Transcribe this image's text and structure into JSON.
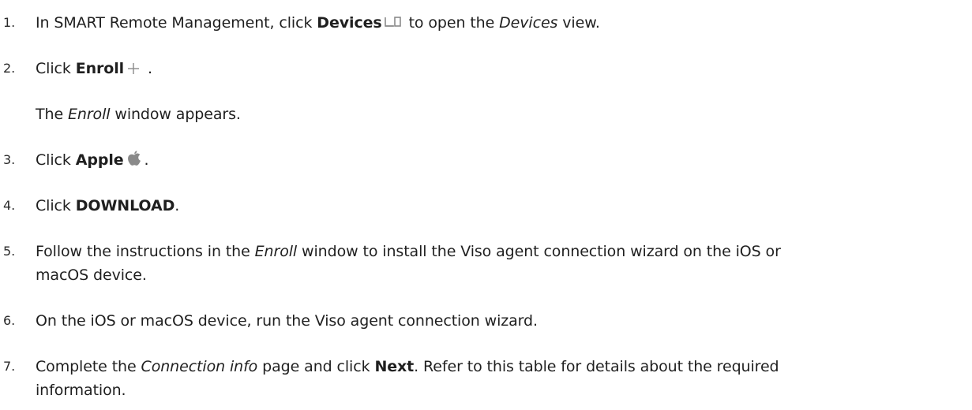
{
  "steps": [
    {
      "number": "1.",
      "parts": {
        "a": "In SMART Remote Management, click ",
        "b": "Devices",
        "c": " to open the ",
        "d": "Devices",
        "e": " view."
      },
      "icon": "devices-icon"
    },
    {
      "number": "2.",
      "parts": {
        "a": "Click ",
        "b": "Enroll",
        "c": " ."
      },
      "icon": "plus-icon",
      "note": {
        "a": "The ",
        "b": "Enroll",
        "c": " window appears."
      }
    },
    {
      "number": "3.",
      "parts": {
        "a": "Click ",
        "b": "Apple",
        "c": "."
      },
      "icon": "apple-icon"
    },
    {
      "number": "4.",
      "parts": {
        "a": "Click ",
        "b": "DOWNLOAD",
        "c": "."
      }
    },
    {
      "number": "5.",
      "parts": {
        "a": "Follow the instructions in the ",
        "b": "Enroll",
        "c": " window to install the Viso agent connection wizard on the iOS or",
        "d": "macOS device."
      }
    },
    {
      "number": "6.",
      "parts": {
        "a": "On the iOS or macOS device, run the Viso agent connection wizard."
      }
    },
    {
      "number": "7.",
      "parts": {
        "a": "Complete the ",
        "b": "Connection info",
        "c": " page and click ",
        "d": "Next",
        "e": ". Refer to this table for details about the required",
        "f": "information."
      }
    }
  ],
  "colors": {
    "text": "#1f1f1f",
    "icon": "#8a8a8a"
  }
}
